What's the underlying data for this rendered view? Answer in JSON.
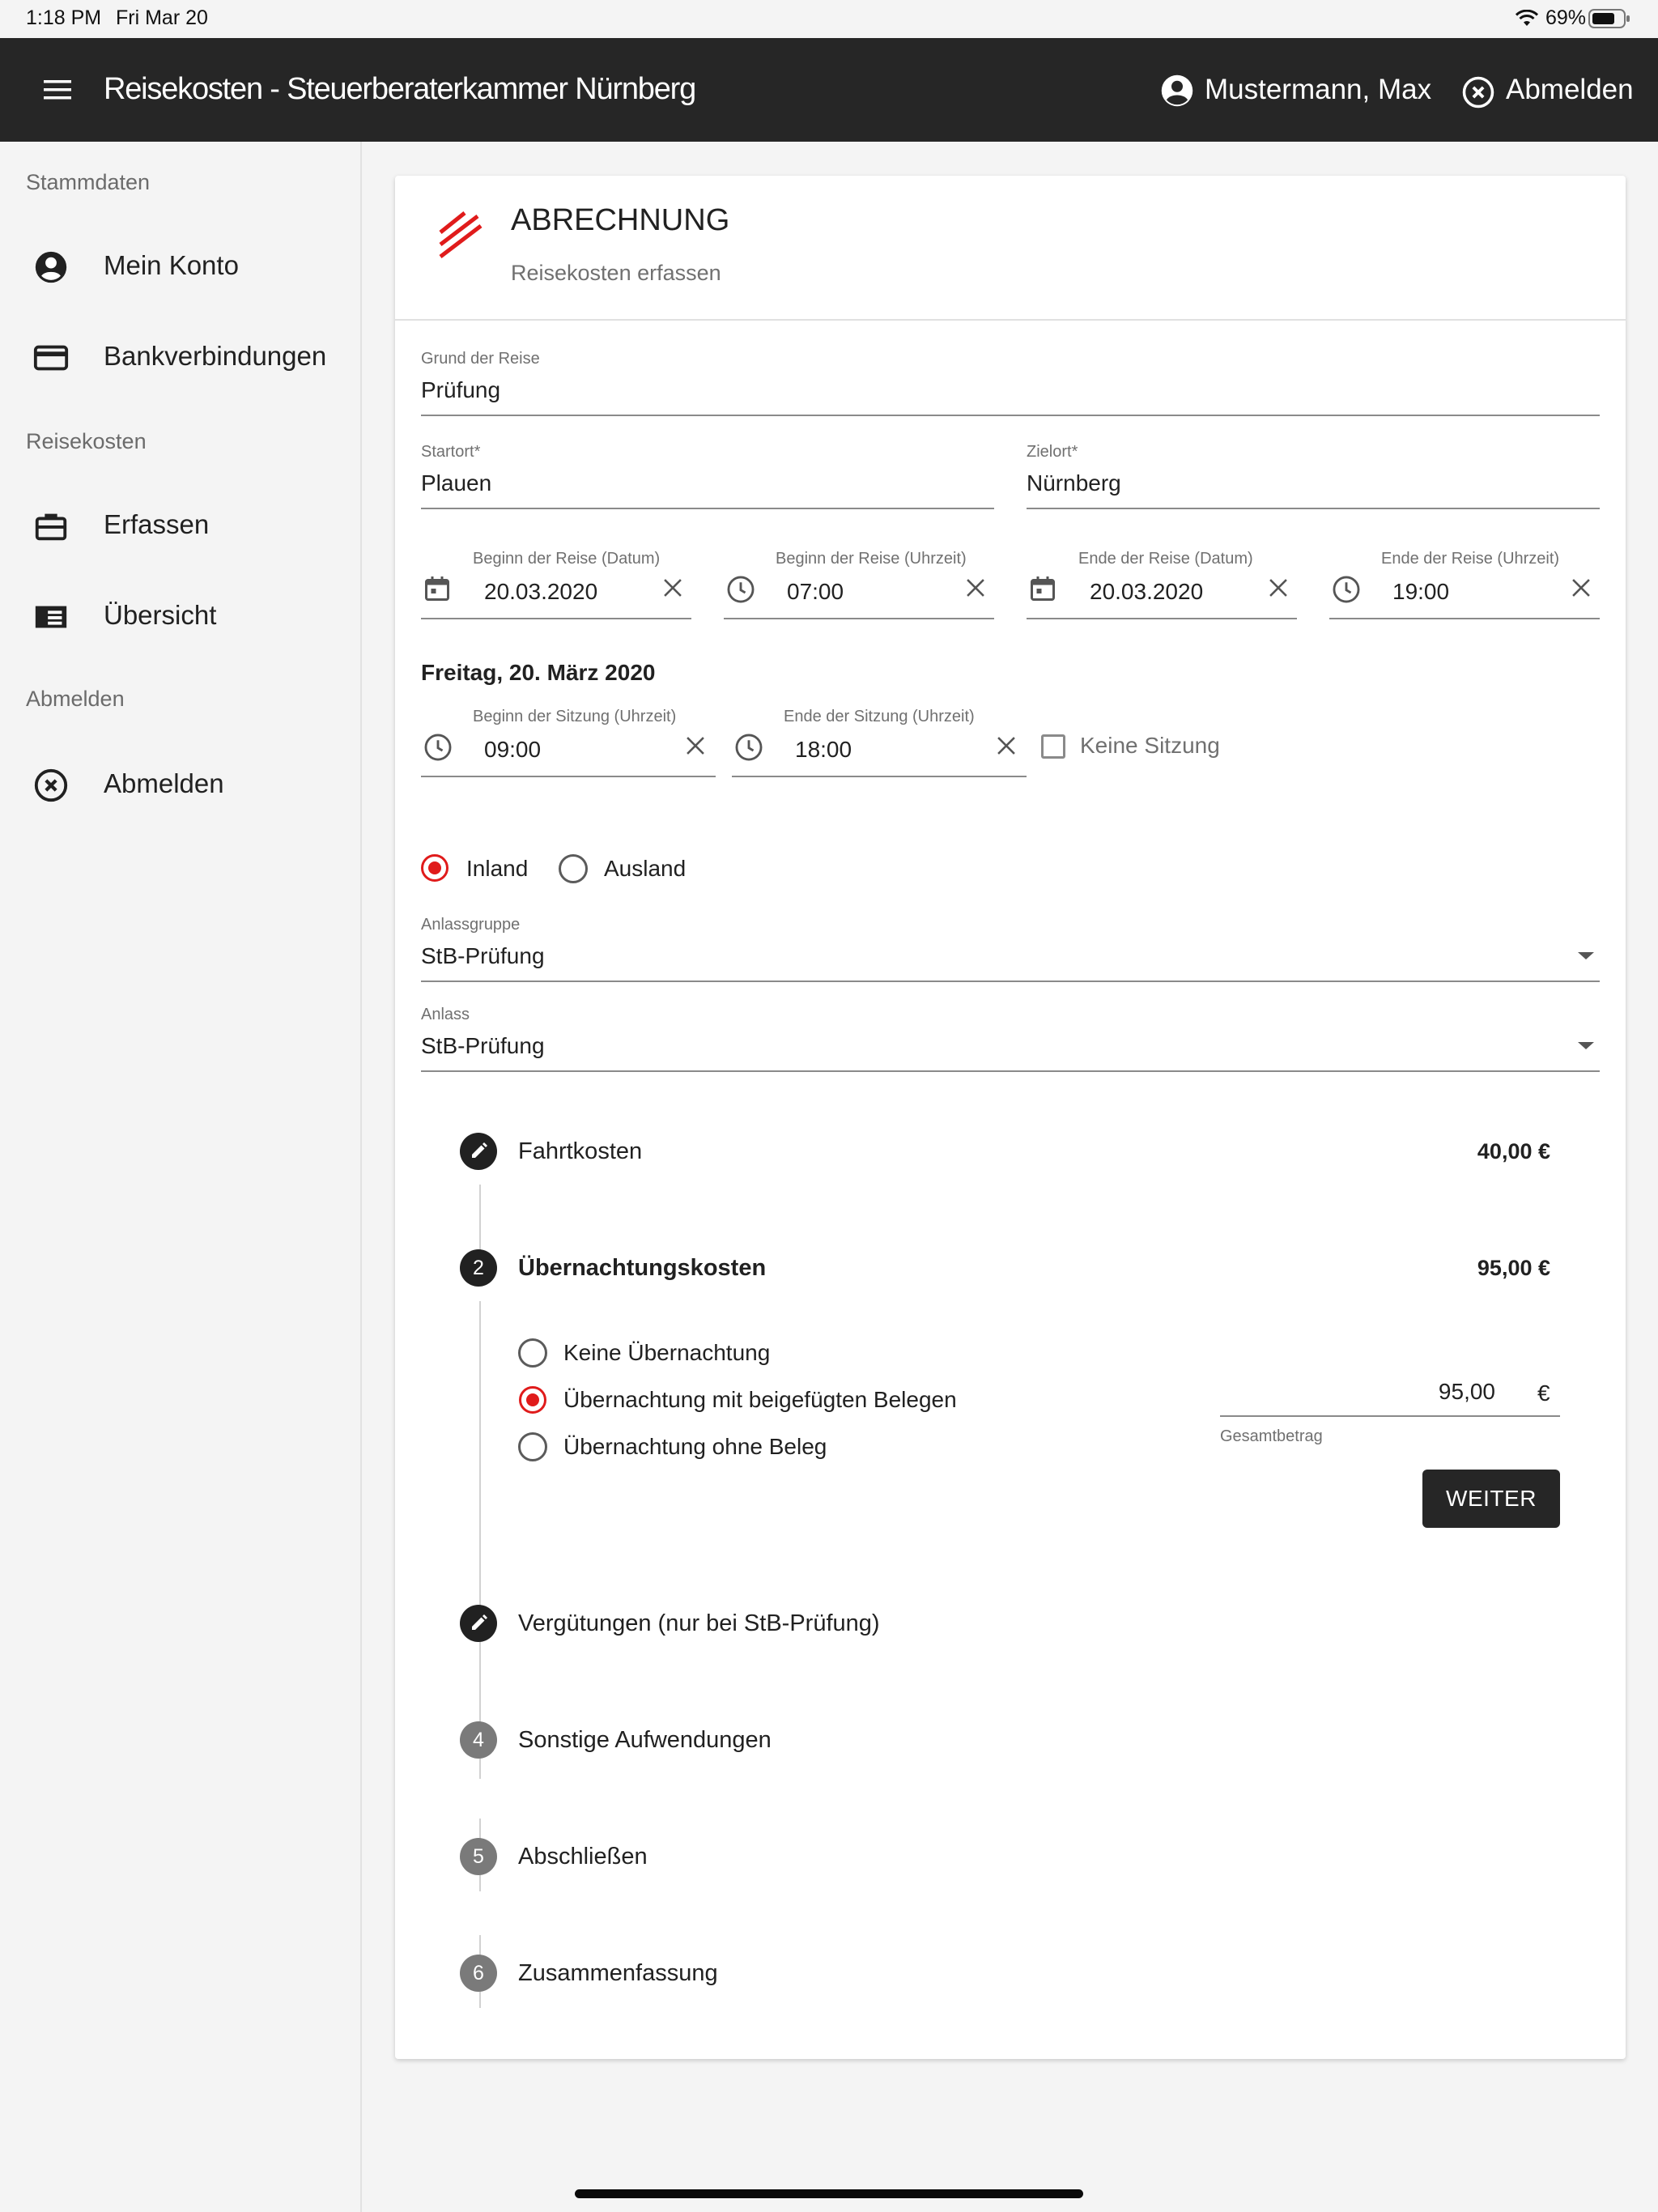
{
  "status": {
    "time": "1:18 PM",
    "date": "Fri Mar 20",
    "battery": "69%"
  },
  "appbar": {
    "title": "Reisekosten - Steuerberaterkammer Nürnberg",
    "user": "Mustermann, Max",
    "logout": "Abmelden"
  },
  "sidebar": {
    "sections": [
      "Stammdaten",
      "Reisekosten",
      "Abmelden"
    ],
    "items": [
      {
        "label": "Mein Konto",
        "icon": "account-circle-icon"
      },
      {
        "label": "Bankverbindungen",
        "icon": "credit-card-icon"
      },
      {
        "label": "Erfassen",
        "icon": "briefcase-icon"
      },
      {
        "label": "Übersicht",
        "icon": "list-view-icon"
      },
      {
        "label": "Abmelden",
        "icon": "close-circle-icon"
      }
    ]
  },
  "card": {
    "title": "ABRECHNUNG",
    "subtitle": "Reisekosten erfassen",
    "accent": "#e01b1b",
    "grund": {
      "label": "Grund der Reise",
      "value": "Prüfung"
    },
    "startort": {
      "label": "Startort*",
      "value": "Plauen"
    },
    "zielort": {
      "label": "Zielort*",
      "value": "Nürnberg"
    },
    "beginn_datum": {
      "label": "Beginn der Reise (Datum)",
      "value": "20.03.2020"
    },
    "beginn_zeit": {
      "label": "Beginn der Reise (Uhrzeit)",
      "value": "07:00"
    },
    "ende_datum": {
      "label": "Ende der Reise (Datum)",
      "value": "20.03.2020"
    },
    "ende_zeit": {
      "label": "Ende der Reise (Uhrzeit)",
      "value": "19:00"
    },
    "day_heading": "Freitag, 20. März 2020",
    "sitzung_beginn": {
      "label": "Beginn der Sitzung (Uhrzeit)",
      "value": "09:00"
    },
    "sitzung_ende": {
      "label": "Ende der Sitzung (Uhrzeit)",
      "value": "18:00"
    },
    "keine_sitzung": "Keine Sitzung",
    "inland": "Inland",
    "ausland": "Ausland",
    "anlassgruppe": {
      "label": "Anlassgruppe",
      "value": "StB-Prüfung"
    },
    "anlass": {
      "label": "Anlass",
      "value": "StB-Prüfung"
    }
  },
  "steps": {
    "s1": {
      "label": "Fahrtkosten",
      "amount": "40,00 €"
    },
    "s2": {
      "num": "2",
      "label": "Übernachtungskosten",
      "amount": "95,00 €"
    },
    "s3": {
      "label": "Vergütungen (nur bei StB-Prüfung)"
    },
    "s4": {
      "num": "4",
      "label": "Sonstige Aufwendungen"
    },
    "s5": {
      "num": "5",
      "label": "Abschließen"
    },
    "s6": {
      "num": "6",
      "label": "Zusammenfassung"
    }
  },
  "overnight": {
    "opt1": "Keine Übernachtung",
    "opt2": "Übernachtung mit beigefügten Belegen",
    "opt3": "Übernachtung ohne Beleg",
    "amount": "95,00",
    "currency": "€",
    "amount_label": "Gesamtbetrag",
    "next": "WEITER"
  }
}
